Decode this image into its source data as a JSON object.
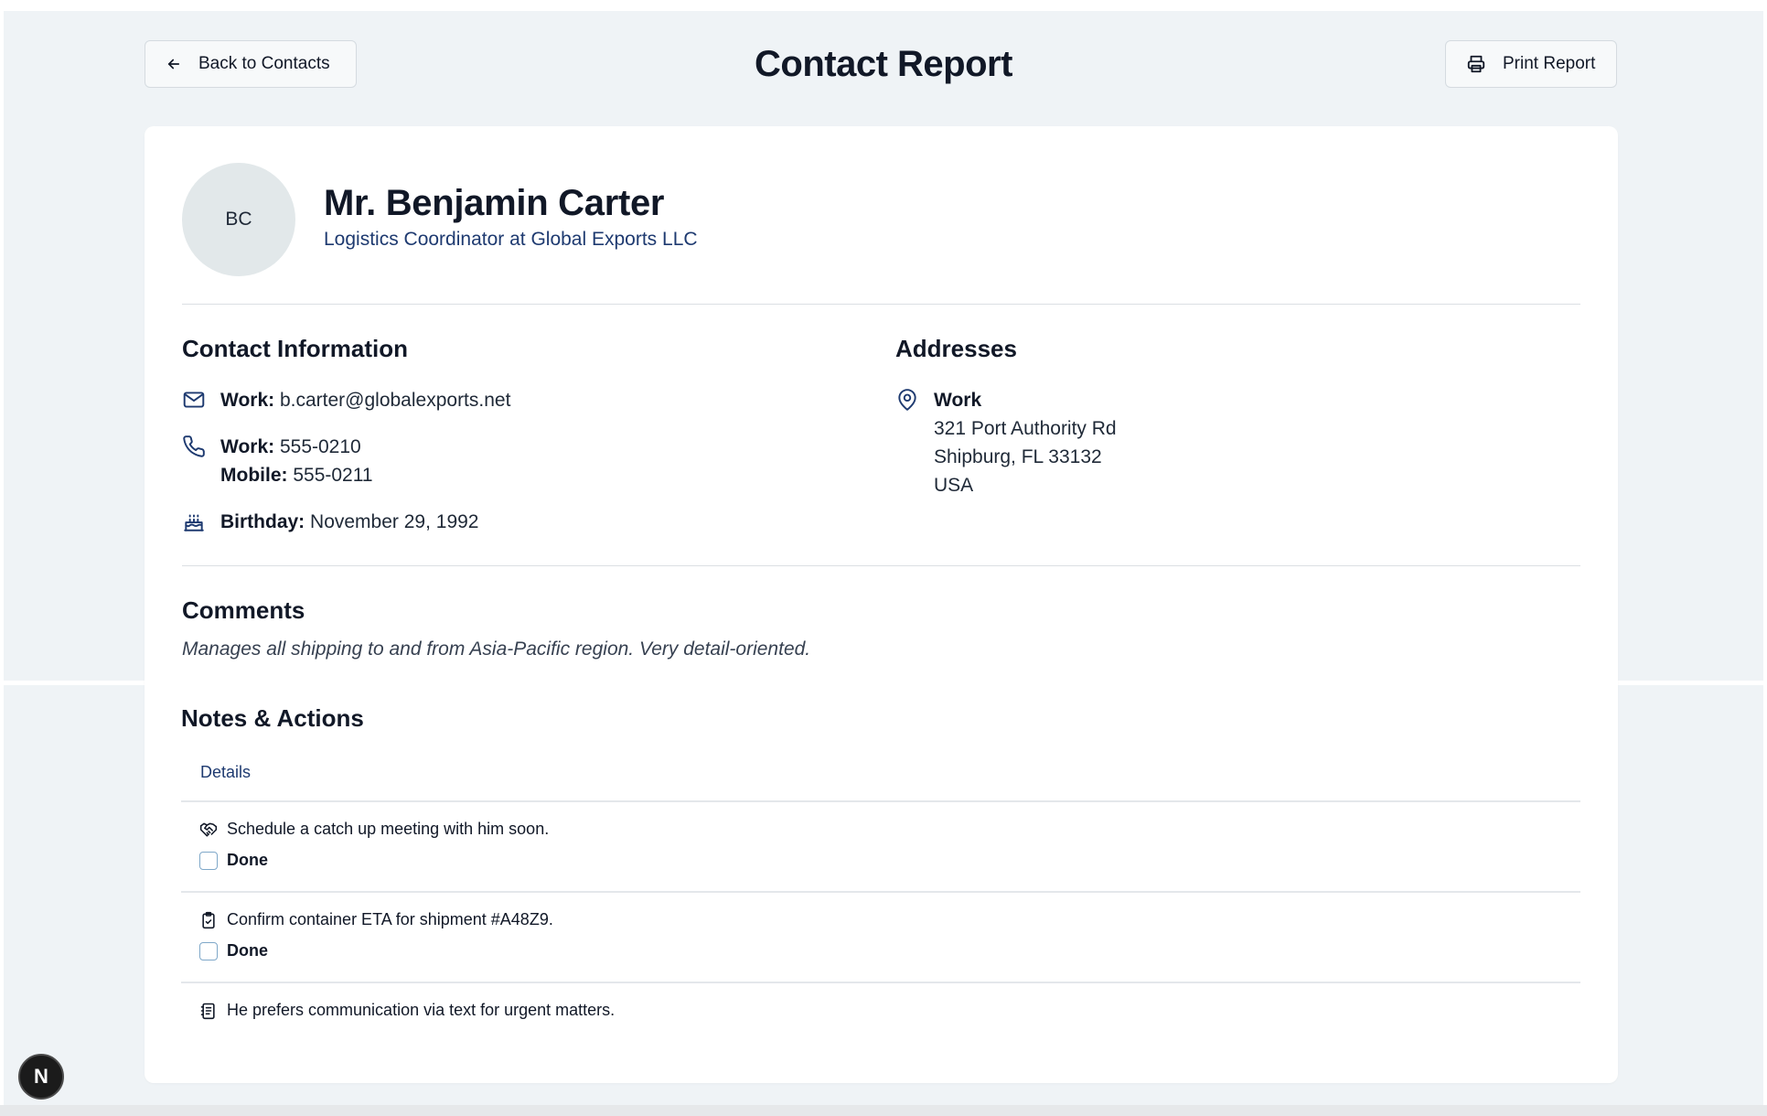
{
  "header": {
    "back_label": "Back to Contacts",
    "title": "Contact Report",
    "print_label": "Print Report"
  },
  "contact": {
    "initials": "BC",
    "name": "Mr. Benjamin Carter",
    "subtitle": "Logistics Coordinator at Global Exports LLC"
  },
  "contact_info": {
    "heading": "Contact Information",
    "email": {
      "label": "Work:",
      "value": "b.carter@globalexports.net"
    },
    "phones": [
      {
        "label": "Work:",
        "value": "555-0210"
      },
      {
        "label": "Mobile:",
        "value": "555-0211"
      }
    ],
    "birthday": {
      "label": "Birthday:",
      "value": "November 29, 1992"
    }
  },
  "addresses": {
    "heading": "Addresses",
    "items": [
      {
        "type": "Work",
        "lines": [
          "321 Port Authority Rd",
          "Shipburg, FL 33132",
          "USA"
        ]
      }
    ]
  },
  "comments": {
    "heading": "Comments",
    "text": "Manages all shipping to and from Asia-Pacific region. Very detail-oriented."
  },
  "notes": {
    "heading": "Notes & Actions",
    "tab": "Details",
    "items": [
      {
        "icon": "handshake-icon",
        "text": "Schedule a catch up meeting with him soon.",
        "done_label": "Done",
        "done": false
      },
      {
        "icon": "clipboard-check-icon",
        "text": "Confirm container ETA for shipment #A48Z9.",
        "done_label": "Done",
        "done": false
      },
      {
        "icon": "notes-icon",
        "text": "He prefers communication via text for urgent matters."
      }
    ]
  },
  "fab": {
    "label": "N"
  },
  "colors": {
    "page_bg": "#eff3f6",
    "card_bg": "#ffffff",
    "accent": "#1e3a70",
    "checkbox_border": "#7fa8c9"
  }
}
